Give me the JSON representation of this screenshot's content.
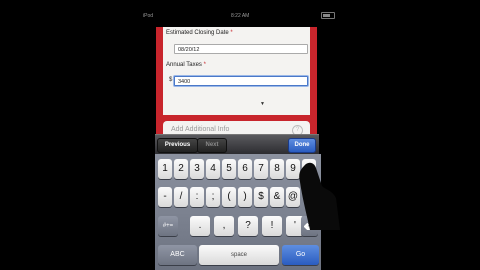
{
  "status_bar": {
    "carrier": "iPod",
    "time": "8:22 AM"
  },
  "form": {
    "closing_date": {
      "label": "Estimated Closing Date",
      "required_mark": "*",
      "value": "08/20/12"
    },
    "annual_taxes": {
      "label": "Annual Taxes",
      "required_mark": "*",
      "currency": "$",
      "value": "3400"
    },
    "additional_info": {
      "label": "Add Additional Info"
    }
  },
  "toolbar": {
    "previous": "Previous",
    "next": "Next",
    "done": "Done"
  },
  "keyboard": {
    "row1": [
      "1",
      "2",
      "3",
      "4",
      "5",
      "6",
      "7",
      "8",
      "9",
      "0"
    ],
    "row2": [
      "-",
      "/",
      ":",
      ";",
      "(",
      ")",
      "$",
      "&",
      "@"
    ],
    "row3_left": "#+=",
    "row3": [
      ".",
      ",",
      "?",
      "!",
      "'"
    ],
    "abc": "ABC",
    "space": "space",
    "go": "Go"
  }
}
